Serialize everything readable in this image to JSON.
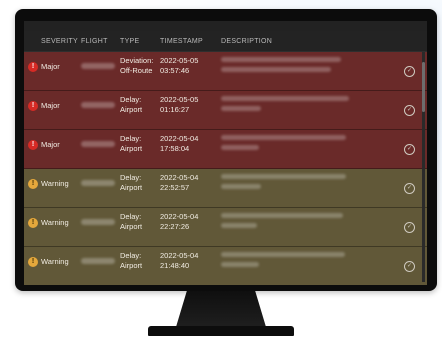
{
  "table": {
    "columns": {
      "severity": "SEVERITY",
      "flight": "FLIGHT",
      "type": "TYPE",
      "timestamp": "TIMESTAMP",
      "description": "DESCRIPTION"
    },
    "rows": [
      {
        "severity": "Major",
        "type_line1": "Deviation:",
        "type_line2": "Off-Route",
        "date": "2022-05-05",
        "time": "03:57:46",
        "icon": "alert-triangle-icon"
      },
      {
        "severity": "Major",
        "type_line1": "Delay:",
        "type_line2": "Airport",
        "date": "2022-05-05",
        "time": "01:16:27",
        "icon": "alert-icon"
      },
      {
        "severity": "Major",
        "type_line1": "Delay:",
        "type_line2": "Airport",
        "date": "2022-05-04",
        "time": "17:58:04",
        "icon": "alert-icon"
      },
      {
        "severity": "Warning",
        "type_line1": "Delay:",
        "type_line2": "Airport",
        "date": "2022-05-04",
        "time": "22:52:57",
        "icon": "warning-icon"
      },
      {
        "severity": "Warning",
        "type_line1": "Delay:",
        "type_line2": "Airport",
        "date": "2022-05-04",
        "time": "22:27:26",
        "icon": "warning-icon"
      },
      {
        "severity": "Warning",
        "type_line1": "Delay:",
        "type_line2": "Airport",
        "date": "2022-05-04",
        "time": "21:48:40",
        "icon": "warning-icon"
      }
    ]
  },
  "colors": {
    "major_row": "#6a2a29",
    "warning_row": "#615838",
    "major_icon": "#d62a25",
    "warning_icon": "#e5a83c"
  }
}
